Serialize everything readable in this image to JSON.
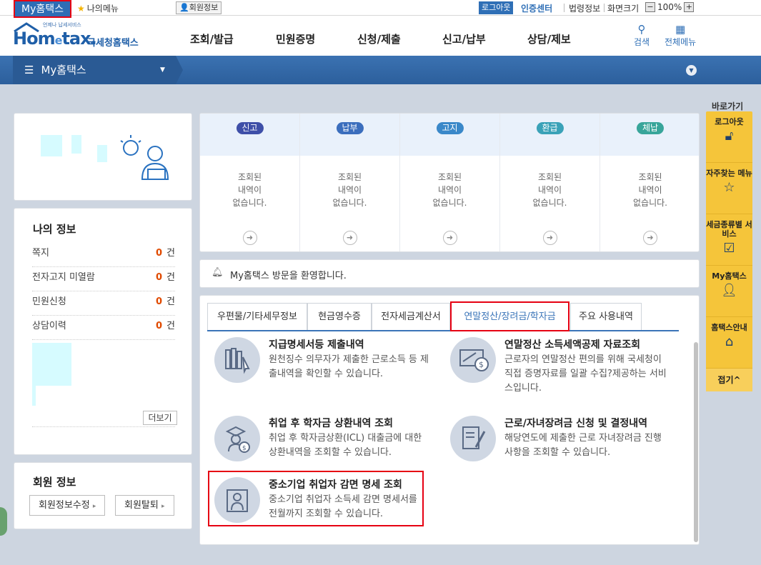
{
  "topbar": {
    "my_hometax": "My홈택스",
    "my_menu": "나의메뉴",
    "member_info": "회원정보",
    "logout": "로그아웃",
    "cert_center": "인증센터",
    "law_info": "법령정보",
    "screen_size": "화면크기",
    "zoom": "100%"
  },
  "logo": {
    "small": "언제나 납세서비스",
    "main_a": "Hom",
    "main_e": "e",
    "main_b": "tax.",
    "korean": "국세청홈택스"
  },
  "nav": [
    "조회/발급",
    "민원증명",
    "신청/제출",
    "신고/납부",
    "상담/제보"
  ],
  "header_icons": {
    "search": "검색",
    "all_menu": "전체메뉴"
  },
  "mybar": {
    "title": "My홈택스"
  },
  "my_info": {
    "title": "나의 정보",
    "unit": "건",
    "rows": [
      {
        "label": "쪽지",
        "count": "0"
      },
      {
        "label": "전자고지 미열람",
        "count": "0"
      },
      {
        "label": "민원신청",
        "count": "0"
      },
      {
        "label": "상담이력",
        "count": "0"
      }
    ],
    "more": "더보기"
  },
  "member_info": {
    "title": "회원 정보",
    "edit": "회원정보수정",
    "withdraw": "회원탈퇴"
  },
  "tax_status": [
    {
      "label": "신고",
      "color": "#3e4fa8",
      "msg_lines": [
        "조회된",
        "내역이",
        "없습니다."
      ]
    },
    {
      "label": "납부",
      "color": "#3b6ebd",
      "msg_lines": [
        "조회된",
        "내역이",
        "없습니다."
      ]
    },
    {
      "label": "고지",
      "color": "#3a88c9",
      "msg_lines": [
        "조회된",
        "내역이",
        "없습니다."
      ]
    },
    {
      "label": "환급",
      "color": "#3aa2b8",
      "msg_lines": [
        "조회된",
        "내역이",
        "없습니다."
      ]
    },
    {
      "label": "체납",
      "color": "#38a59a",
      "msg_lines": [
        "조회된",
        "내역이",
        "없습니다."
      ]
    }
  ],
  "welcome": "My홈택스 방문을 환영합니다.",
  "tabs": [
    {
      "label": "우편물/기타세무정보",
      "active": false
    },
    {
      "label": "현금영수증",
      "active": false
    },
    {
      "label": "전자세금계산서",
      "active": false
    },
    {
      "label": "연말정산/장려금/학자금",
      "active": true
    },
    {
      "label": "주요 사용내역",
      "active": false
    }
  ],
  "services": [
    {
      "title": "지급명세서등 제출내역",
      "desc": "원천징수 의무자가 제출한 근로소득 등 제출내역을 확인할 수 있습니다.",
      "icon": "books-icon"
    },
    {
      "title": "연말정산 소득세액공제 자료조회",
      "desc": "근로자의 연말정산 편의를 위해 국세청이 직접 증명자료를 일괄 수집?제공하는 서비스입니다.",
      "icon": "monitor-coin-icon"
    },
    {
      "title": "취업 후 학자금 상환내역 조회",
      "desc": "취업 후 학자금상환(ICL) 대출금에 대한 상환내역을 조회할 수 있습니다.",
      "icon": "graduate-icon"
    },
    {
      "title": "근로/자녀장려금 신청 및 결정내역",
      "desc": "해당연도에 제출한 근로 자녀장려금 진행사항을 조회할 수 있습니다.",
      "icon": "document-pen-icon"
    },
    {
      "title": "중소기업 취업자 감면 명세 조회",
      "desc": "중소기업 취업자 소득세 감면 명세서를 전월까지 조회할 수 있습니다.",
      "icon": "worker-icon"
    }
  ],
  "quick": {
    "label": "바로가기",
    "items": [
      {
        "label": "로그아웃",
        "icon": "unlock-icon"
      },
      {
        "label": "자주찾는 메뉴",
        "icon": "star-icon"
      },
      {
        "label": "세금종류별 서비스",
        "icon": "checkbox-icon"
      },
      {
        "label": "My홈택스",
        "icon": "user-icon"
      },
      {
        "label": "홈택스안내",
        "icon": "guide-icon"
      }
    ],
    "close": "접기"
  }
}
